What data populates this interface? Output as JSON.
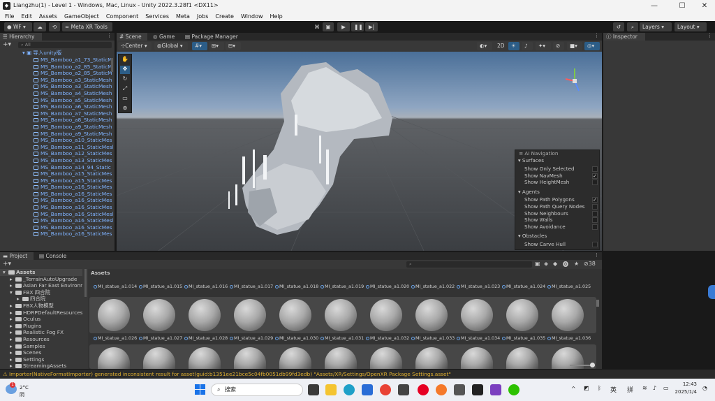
{
  "window": {
    "title": "Liangzhu(1) - Level 1 - Windows, Mac, Linux - Unity 2022.3.28f1 <DX11>",
    "minimize": "—",
    "maximize": "☐",
    "close": "✕"
  },
  "menu": [
    "File",
    "Edit",
    "Assets",
    "GameObject",
    "Component",
    "Services",
    "Meta",
    "Jobs",
    "Create",
    "Window",
    "Help"
  ],
  "toolbar": {
    "account": "WF",
    "meta_xr": "Meta XR Tools",
    "layers": "Layers",
    "layout": "Layout"
  },
  "hierarchy": {
    "tab": "Hierarchy",
    "search_placeholder": "All",
    "root": "导入unity版",
    "items": [
      "MS_Bamboo_a1_73_StaticM",
      "MS_Bamboo_a2_85_StaticM",
      "MS_Bamboo_a2_85_StaticM",
      "MS_Bamboo_a3_StaticMesh",
      "MS_Bamboo_a3_StaticMesh",
      "MS_Bamboo_a4_StaticMesh",
      "MS_Bamboo_a5_StaticMesh",
      "MS_Bamboo_a6_StaticMesh",
      "MS_Bamboo_a7_StaticMesh",
      "MS_Bamboo_a8_StaticMesh",
      "MS_Bamboo_a9_StaticMesh",
      "MS_Bamboo_a9_StaticMesh",
      "MS_Bamboo_a10_StaticMes",
      "MS_Bamboo_a11_StaticMesl",
      "MS_Bamboo_a12_StaticMes",
      "MS_Bamboo_a13_StaticMes",
      "MS_Bamboo_a14_94_Static",
      "MS_Bamboo_a15_StaticMes",
      "MS_Bamboo_a15_StaticMes",
      "MS_Bamboo_a16_StaticMes",
      "MS_Bamboo_a16_StaticMes",
      "MS_Bamboo_a16_StaticMes",
      "MS_Bamboo_a16_StaticMes",
      "MS_Bamboo_a16_StaticMesl",
      "MS_Bamboo_a16_StaticMesl",
      "MS_Bamboo_a16_StaticMes",
      "MS_Bamboo_a16_StaticMes"
    ]
  },
  "scene": {
    "tabs": [
      "Scene",
      "Game",
      "Package Manager"
    ],
    "pivot": "Center",
    "space": "Global",
    "mode_2d": "2D"
  },
  "ai_navigation": {
    "title": "AI Navigation",
    "sections": [
      {
        "name": "Surfaces",
        "items": [
          {
            "label": "Show Only Selected",
            "checked": ""
          },
          {
            "label": "Show NavMesh",
            "checked": "✓"
          },
          {
            "label": "Show HeightMesh",
            "checked": ""
          }
        ]
      },
      {
        "name": "Agents",
        "items": [
          {
            "label": "Show Path Polygons",
            "checked": "✓"
          },
          {
            "label": "Show Path Query Nodes",
            "checked": ""
          },
          {
            "label": "Show Neighbours",
            "checked": ""
          },
          {
            "label": "Show Walls",
            "checked": ""
          },
          {
            "label": "Show Avoidance",
            "checked": ""
          }
        ]
      },
      {
        "name": "Obstacles",
        "items": [
          {
            "label": "Show Carve Hull",
            "checked": ""
          }
        ]
      }
    ]
  },
  "inspector": {
    "tab": "Inspector"
  },
  "project": {
    "tabs": [
      "Project",
      "Console"
    ],
    "breadcrumb": "Assets",
    "hidden_count": "38",
    "tree": [
      {
        "label": "Assets",
        "depth": 0
      },
      {
        "label": "_TerrainAutoUpgrade",
        "depth": 1
      },
      {
        "label": "Asian Far East Environme",
        "depth": 1
      },
      {
        "label": "FBX 四合院",
        "depth": 1
      },
      {
        "label": "四合院",
        "depth": 2
      },
      {
        "label": "FBX人物模型",
        "depth": 1
      },
      {
        "label": "HDRPDefaultResources",
        "depth": 1
      },
      {
        "label": "Oculus",
        "depth": 1
      },
      {
        "label": "Plugins",
        "depth": 1
      },
      {
        "label": "Realistic Fog FX",
        "depth": 1
      },
      {
        "label": "Resources",
        "depth": 1
      },
      {
        "label": "Samples",
        "depth": 1
      },
      {
        "label": "Scenes",
        "depth": 1
      },
      {
        "label": "Settings",
        "depth": 1
      },
      {
        "label": "StreamingAssets",
        "depth": 1
      }
    ],
    "top_labels": [
      "MI_statue_a1.014",
      "MI_statue_a1.015",
      "MI_statue_a1.016",
      "MI_statue_a1.017",
      "MI_statue_a1.018",
      "MI_statue_a1.019",
      "MI_statue_a1.020",
      "MI_statue_a1.022",
      "MI_statue_a1.023",
      "MI_statue_a1.024",
      "MI_statue_a1.025"
    ],
    "mid_labels": [
      "MI_statue_a1.026",
      "MI_statue_a1.027",
      "MI_statue_a1.028",
      "MI_statue_a1.029",
      "MI_statue_a1.030",
      "MI_statue_a1.031",
      "MI_statue_a1.032",
      "MI_statue_a1.033",
      "MI_statue_a1.034",
      "MI_statue_a1.035",
      "MI_statue_a1.036"
    ]
  },
  "status": {
    "message": "Importer(NativeFormatImporter) generated inconsistent result for asset(guid:b1351ee21bce5c04fb0051db99fd3edb) \"Assets/XR/Settings/OpenXR Package Settings.asset\""
  },
  "taskbar": {
    "weather_temp": "2°C",
    "weather_desc": "阴",
    "search_placeholder": "搜索",
    "ime_lang": "英",
    "ime_mode": "拼",
    "time": "12:43",
    "date": "2025/1/4",
    "notification_count": "1"
  },
  "colors": {
    "accent": "#2c5d87",
    "hierarchy_text": "#7fb3ff",
    "warning": "#e0b030"
  }
}
